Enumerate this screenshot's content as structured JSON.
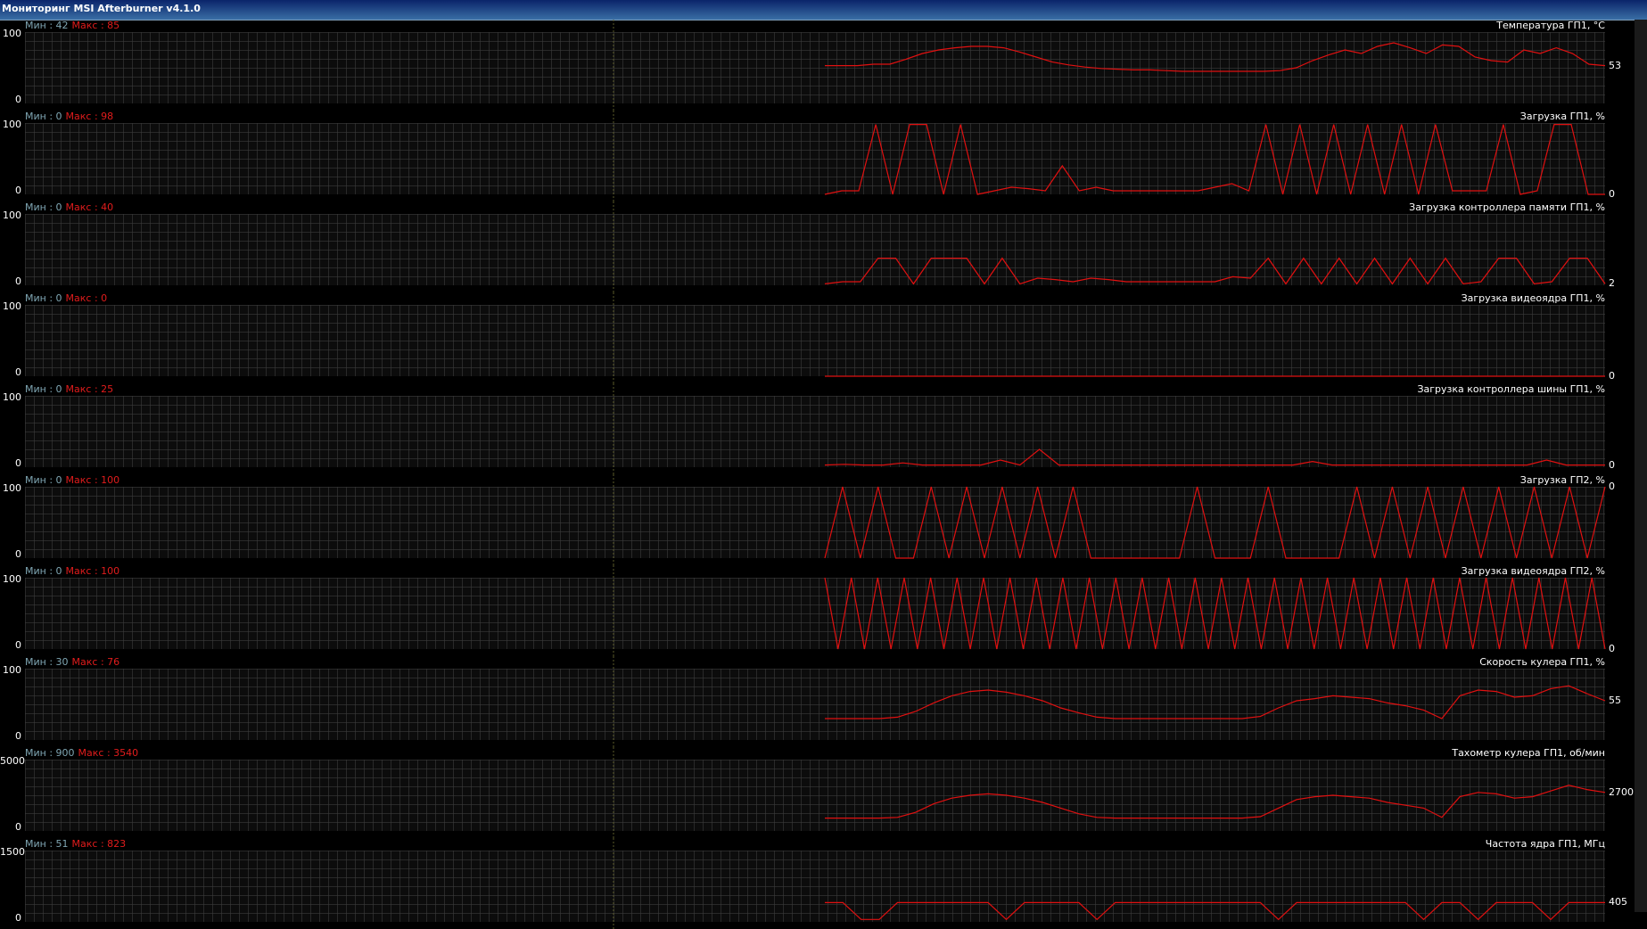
{
  "window": {
    "title": "Мониторинг MSI Afterburner v4.1.0"
  },
  "panels": [
    {
      "name": "Температура ГП1, °C",
      "min_label": "Мин : 42",
      "max_label": "Макс : 85",
      "axis_top": "100",
      "axis_bottom": "0",
      "current": "53",
      "chart_data": {
        "type": "line",
        "ylim": [
          0,
          100
        ],
        "values": [
          53,
          53,
          53,
          55,
          55,
          62,
          70,
          75,
          78,
          80,
          80,
          78,
          72,
          65,
          58,
          54,
          51,
          49,
          48,
          47,
          47,
          46,
          45,
          45,
          45,
          45,
          45,
          45,
          46,
          50,
          60,
          68,
          75,
          70,
          80,
          85,
          78,
          70,
          82,
          80,
          65,
          60,
          58,
          75,
          70,
          78,
          70,
          55,
          53
        ]
      }
    },
    {
      "name": "Загрузка ГП1, %",
      "min_label": "Мин : 0",
      "max_label": "Макс : 98",
      "axis_top": "100",
      "axis_bottom": "0",
      "current": "0",
      "chart_data": {
        "type": "line",
        "ylim": [
          0,
          100
        ],
        "values": [
          0,
          5,
          5,
          98,
          0,
          98,
          98,
          0,
          98,
          0,
          5,
          10,
          8,
          5,
          40,
          5,
          10,
          5,
          5,
          5,
          5,
          5,
          5,
          10,
          15,
          5,
          98,
          0,
          98,
          0,
          98,
          0,
          98,
          0,
          98,
          0,
          98,
          5,
          5,
          5,
          98,
          0,
          5,
          98,
          98,
          0,
          0
        ]
      }
    },
    {
      "name": "Загрузка контроллера памяти ГП1, %",
      "min_label": "Мин : 0",
      "max_label": "Макс : 40",
      "axis_top": "100",
      "axis_bottom": "0",
      "current": "2",
      "chart_data": {
        "type": "line",
        "ylim": [
          0,
          100
        ],
        "values": [
          2,
          5,
          5,
          38,
          38,
          2,
          38,
          38,
          38,
          2,
          38,
          2,
          10,
          8,
          5,
          10,
          8,
          5,
          5,
          5,
          5,
          5,
          5,
          12,
          10,
          38,
          2,
          38,
          2,
          38,
          2,
          38,
          2,
          38,
          2,
          38,
          2,
          5,
          38,
          38,
          2,
          5,
          38,
          38,
          2
        ]
      }
    },
    {
      "name": "Загрузка видеоядра ГП1, %",
      "min_label": "Мин : 0",
      "max_label": "Макс : 0",
      "axis_top": "100",
      "axis_bottom": "0",
      "current": "0",
      "chart_data": {
        "type": "line",
        "ylim": [
          0,
          100
        ],
        "values": [
          0,
          0,
          0,
          0,
          0,
          0,
          0,
          0,
          0,
          0
        ]
      }
    },
    {
      "name": "Загрузка контроллера шины ГП1, %",
      "min_label": "Мин : 0",
      "max_label": "Макс : 25",
      "axis_top": "100",
      "axis_bottom": "0",
      "current": "0",
      "chart_data": {
        "type": "line",
        "ylim": [
          0,
          100
        ],
        "values": [
          3,
          4,
          3,
          3,
          6,
          3,
          3,
          3,
          3,
          10,
          3,
          25,
          3,
          3,
          3,
          3,
          3,
          3,
          3,
          3,
          3,
          3,
          3,
          3,
          3,
          8,
          3,
          3,
          3,
          3,
          3,
          3,
          3,
          3,
          3,
          3,
          3,
          10,
          3,
          3,
          3
        ]
      }
    },
    {
      "name": "Загрузка ГП2, %",
      "min_label": "Мин : 0",
      "max_label": "Макс : 100",
      "axis_top": "100",
      "axis_bottom": "0",
      "current": "0",
      "chart_data": {
        "type": "line",
        "ylim": [
          0,
          100
        ],
        "values": [
          0,
          100,
          0,
          100,
          0,
          0,
          100,
          0,
          100,
          0,
          100,
          0,
          100,
          0,
          100,
          0,
          0,
          0,
          0,
          0,
          0,
          100,
          0,
          0,
          0,
          100,
          0,
          0,
          0,
          0,
          100,
          0,
          100,
          0,
          100,
          0,
          100,
          0,
          100,
          0,
          100,
          0,
          100,
          0,
          100
        ]
      }
    },
    {
      "name": "Загрузка видеоядра ГП2, %",
      "min_label": "Мин : 0",
      "max_label": "Макс : 100",
      "axis_top": "100",
      "axis_bottom": "0",
      "current": "0",
      "chart_data": {
        "type": "line",
        "ylim": [
          0,
          100
        ],
        "values": [
          100,
          0,
          100,
          0,
          100,
          0,
          100,
          0,
          100,
          0,
          100,
          0,
          100,
          0,
          100,
          0,
          100,
          0,
          100,
          0,
          100,
          0,
          100,
          0,
          100,
          0,
          100,
          0,
          100,
          0,
          100,
          0,
          100,
          0,
          100,
          0,
          100,
          0,
          100,
          0,
          100,
          0,
          100,
          0,
          100,
          0,
          100,
          0,
          100,
          0,
          100,
          0,
          100,
          0,
          100,
          0,
          100,
          0,
          100,
          0
        ]
      }
    },
    {
      "name": "Скорость кулера ГП1, %",
      "min_label": "Мин : 30",
      "max_label": "Макс : 76",
      "axis_top": "100",
      "axis_bottom": "0",
      "current": "55",
      "chart_data": {
        "type": "line",
        "ylim": [
          0,
          100
        ],
        "values": [
          30,
          30,
          30,
          30,
          32,
          40,
          52,
          62,
          68,
          70,
          67,
          62,
          55,
          45,
          38,
          32,
          30,
          30,
          30,
          30,
          30,
          30,
          30,
          30,
          33,
          45,
          55,
          58,
          62,
          60,
          58,
          52,
          48,
          42,
          30,
          62,
          70,
          68,
          60,
          62,
          72,
          76,
          65,
          55
        ]
      }
    },
    {
      "name": "Тахометр кулера ГП1, об/мин",
      "min_label": "Мин : 900",
      "max_label": "Макс : 3540",
      "axis_top": "5000",
      "axis_bottom": "0",
      "current": "2700",
      "chart_data": {
        "type": "line",
        "ylim": [
          0,
          5000
        ],
        "values": [
          900,
          900,
          900,
          900,
          950,
          1300,
          1900,
          2300,
          2500,
          2600,
          2500,
          2300,
          2000,
          1600,
          1200,
          950,
          900,
          900,
          900,
          900,
          900,
          900,
          900,
          900,
          1000,
          1600,
          2200,
          2400,
          2500,
          2400,
          2300,
          2000,
          1800,
          1600,
          950,
          2400,
          2700,
          2600,
          2300,
          2400,
          2800,
          3200,
          2900,
          2700
        ]
      }
    },
    {
      "name": "Частота ядра ГП1, МГц",
      "min_label": "Мин : 51",
      "max_label": "Макс : 823",
      "axis_top": "1500",
      "axis_bottom": "0",
      "current": "405",
      "chart_data": {
        "type": "line",
        "ylim": [
          0,
          1500
        ],
        "values": [
          405,
          405,
          51,
          51,
          405,
          405,
          405,
          405,
          405,
          405,
          51,
          405,
          405,
          405,
          405,
          51,
          405,
          405,
          405,
          405,
          405,
          405,
          405,
          405,
          405,
          51,
          405,
          405,
          405,
          405,
          405,
          405,
          405,
          51,
          405,
          405,
          51,
          405,
          405,
          405,
          51,
          405,
          405,
          405
        ]
      }
    }
  ]
}
